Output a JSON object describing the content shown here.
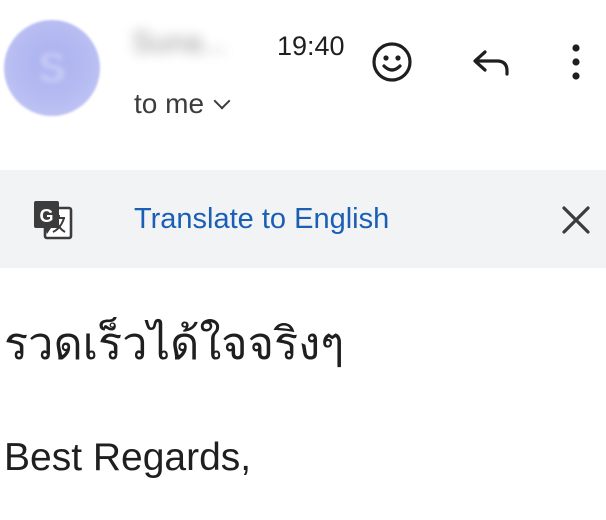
{
  "header": {
    "avatar_letter": "S",
    "sender_name": "Suna...",
    "time": "19:40",
    "recipient": "to me",
    "icons": {
      "emoji": "smiley-face-icon",
      "reply": "reply-arrow-icon",
      "more": "more-vert-icon",
      "recipient_expand": "chevron-down-icon"
    }
  },
  "translate_bar": {
    "label": "Translate to English",
    "icon": "google-translate-icon",
    "close_icon": "close-icon",
    "colors": {
      "background": "#f1f3f5",
      "link": "#1a5fb4"
    }
  },
  "message": {
    "body": "รวดเร็วได้ใจจริงๆ",
    "signature": "Best Regards,"
  },
  "colors": {
    "avatar": "#b3b9f1"
  }
}
